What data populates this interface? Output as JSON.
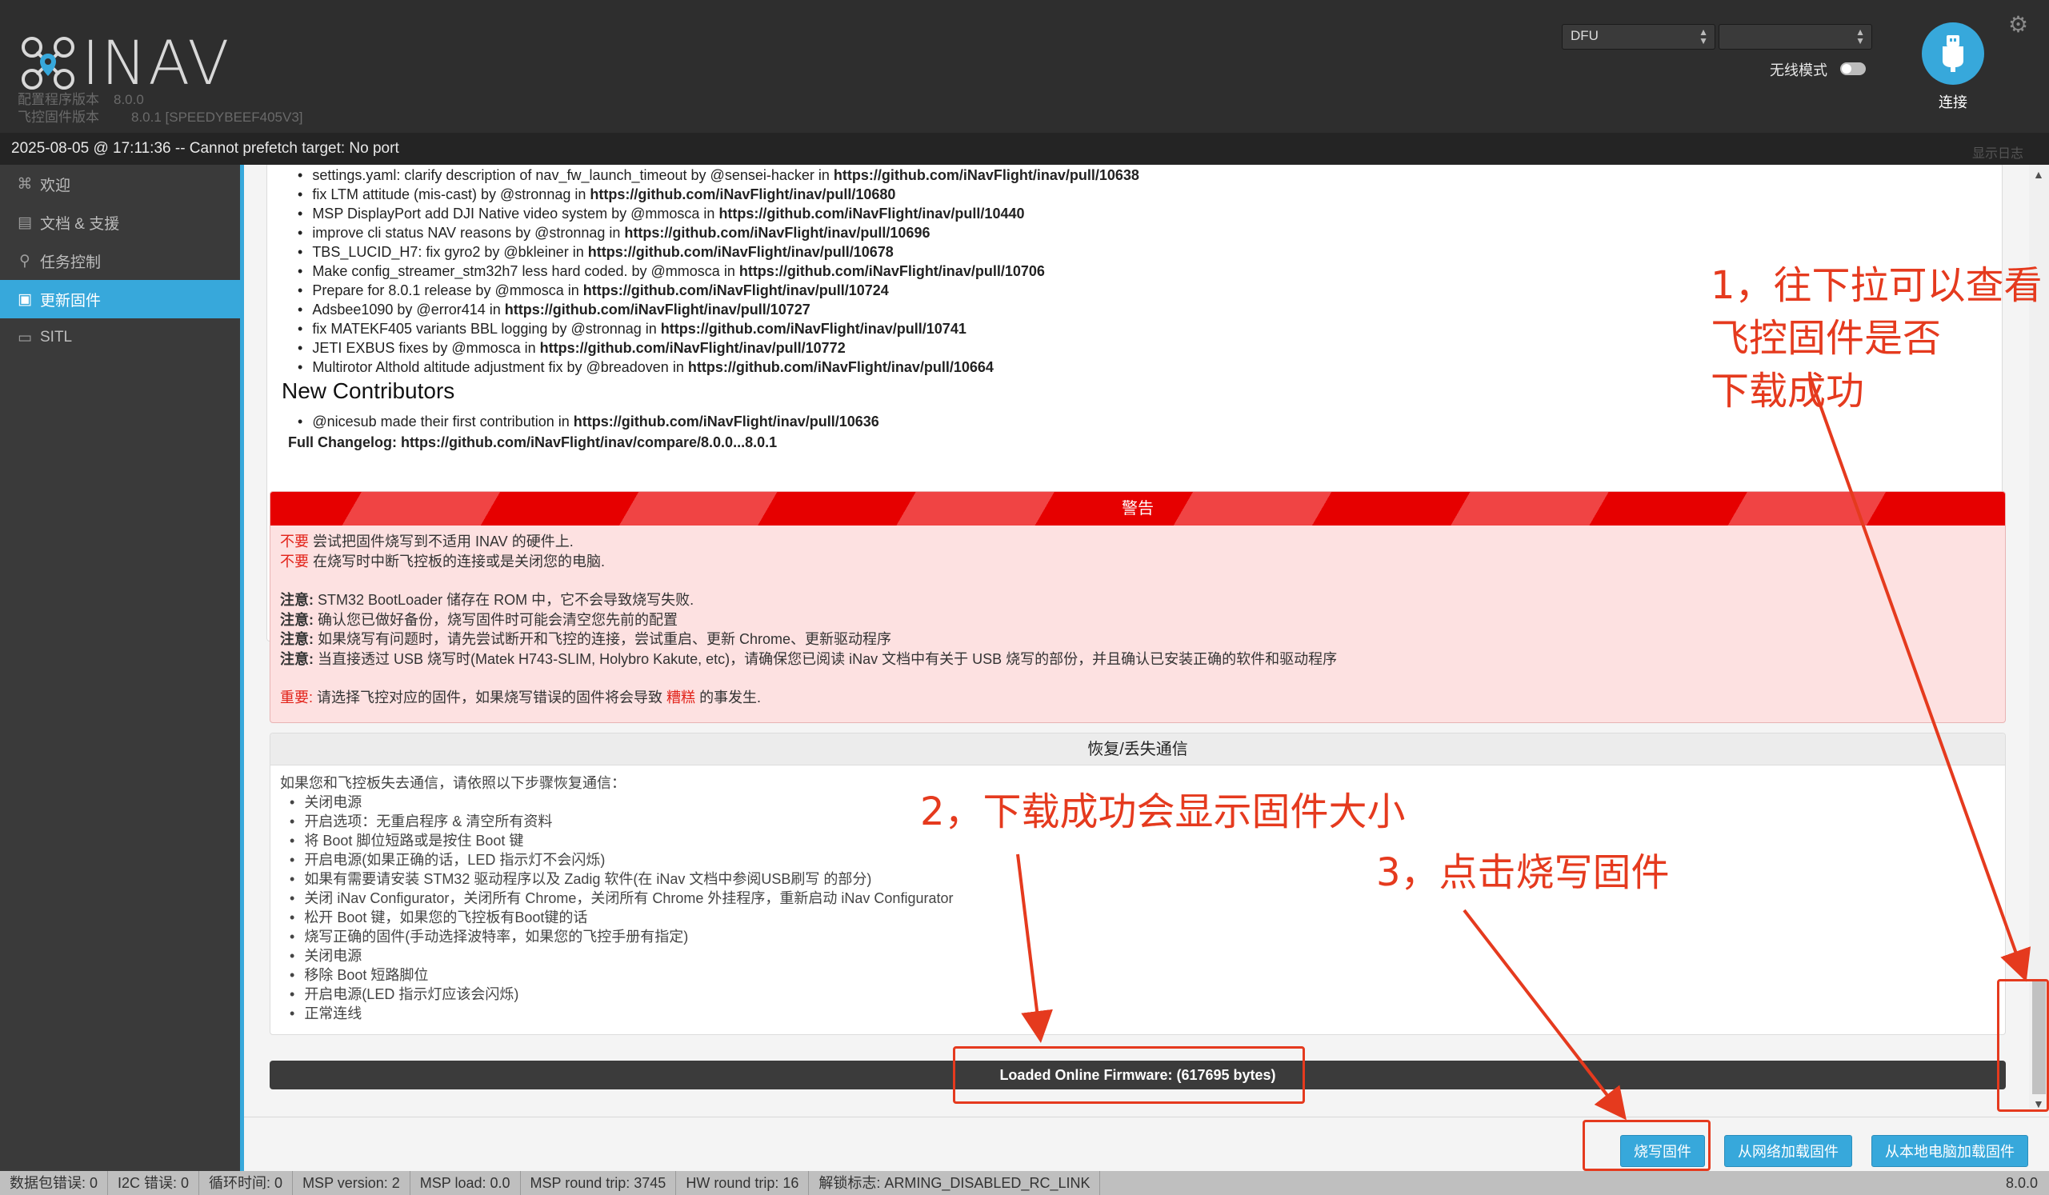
{
  "header": {
    "app_name": "INAV",
    "config_version_label": "配置程序版本",
    "config_version": "8.0.0",
    "firmware_version_label": "飞控固件版本",
    "firmware_version": "8.0.1 [SPEEDYBEEF405V3]",
    "port_select": "DFU",
    "baud_select": "",
    "wireless_label": "无线模式",
    "connect_label": "连接",
    "accent_color": "#37a8db"
  },
  "logbar": {
    "message": "2025-08-05 @ 17:11:36 -- Cannot prefetch target: No port",
    "show_log": "显示日志"
  },
  "sidebar": {
    "items": [
      {
        "label": "欢迎",
        "icon": "welcome-icon"
      },
      {
        "label": "文档 & 支援",
        "icon": "docs-icon"
      },
      {
        "label": "任务控制",
        "icon": "map-pin-icon"
      },
      {
        "label": "更新固件",
        "icon": "chip-icon",
        "active": true
      },
      {
        "label": "SITL",
        "icon": "monitor-icon"
      }
    ]
  },
  "release_notes": {
    "items": [
      {
        "text": "settings.yaml: clarify description of nav_fw_launch_timeout by @sensei-hacker in ",
        "link": "https://github.com/iNavFlight/inav/pull/10638"
      },
      {
        "text": "fix LTM attitude (mis-cast) by @stronnag in ",
        "link": "https://github.com/iNavFlight/inav/pull/10680"
      },
      {
        "text": "MSP DisplayPort add DJI Native video system by @mmosca in ",
        "link": "https://github.com/iNavFlight/inav/pull/10440"
      },
      {
        "text": "improve cli status NAV reasons by @stronnag in ",
        "link": "https://github.com/iNavFlight/inav/pull/10696"
      },
      {
        "text": "TBS_LUCID_H7: fix gyro2 by @bkleiner in ",
        "link": "https://github.com/iNavFlight/inav/pull/10678"
      },
      {
        "text": "Make config_streamer_stm32h7 less hard coded. by @mmosca in ",
        "link": "https://github.com/iNavFlight/inav/pull/10706"
      },
      {
        "text": "Prepare for 8.0.1 release by @mmosca in ",
        "link": "https://github.com/iNavFlight/inav/pull/10724"
      },
      {
        "text": "Adsbee1090 by @error414 in ",
        "link": "https://github.com/iNavFlight/inav/pull/10727"
      },
      {
        "text": "fix MATEKF405 variants BBL logging by @stronnag in ",
        "link": "https://github.com/iNavFlight/inav/pull/10741"
      },
      {
        "text": "JETI EXBUS fixes by @mmosca in ",
        "link": "https://github.com/iNavFlight/inav/pull/10772"
      },
      {
        "text": "Multirotor Althold altitude adjustment fix by @breadoven in ",
        "link": "https://github.com/iNavFlight/inav/pull/10664"
      }
    ],
    "new_contributors_title": "New Contributors",
    "contributor": {
      "text": "@nicesub made their first contribution in ",
      "link": "https://github.com/iNavFlight/inav/pull/10636"
    },
    "full_changelog_label": "Full Changelog",
    "full_changelog_link": "https://github.com/iNavFlight/inav/compare/8.0.0...8.0.1"
  },
  "warning": {
    "title": "警告",
    "line1_prefix": "不要",
    "line1": "尝试把固件烧写到不适用 INAV 的硬件上.",
    "line2_prefix": "不要",
    "line2": "在烧写时中断飞控板的连接或是关闭您的电脑.",
    "note_label": "注意:",
    "note1": "STM32 BootLoader 储存在 ROM 中，它不会导致烧写失败.",
    "note2": "确认您已做好备份，烧写固件时可能会清空您先前的配置",
    "note3": "如果烧写有问题时，请先尝试断开和飞控的连接，尝试重启、更新 Chrome、更新驱动程序",
    "note4": "当直接透过 USB 烧写时(Matek H743-SLIM, Holybro Kakute, etc)，请确保您已阅读 iNav 文档中有关于 USB 烧写的部份，并且确认已安装正确的软件和驱动程序",
    "important_label": "重要:",
    "important_a": "请选择飞控对应的固件，如果烧写错误的固件将会导致",
    "important_bad": "糟糕",
    "important_b": "的事发生."
  },
  "recovery": {
    "title": "恢复/丢失通信",
    "intro": "如果您和飞控板失去通信，请依照以下步骤恢复通信：",
    "steps": [
      "关闭电源",
      "开启选项：无重启程序 & 清空所有资料",
      "将 Boot 脚位短路或是按住 Boot 键",
      "开启电源(如果正确的话，LED 指示灯不会闪烁)",
      "如果有需要请安装 STM32 驱动程序以及 Zadig 软件(在 iNav 文档中参阅USB刷写 的部分)",
      "关闭 iNav Configurator，关闭所有 Chrome，关闭所有 Chrome 外挂程序，重新启动 iNav Configurator",
      "松开 Boot 键，如果您的飞控板有Boot键的话",
      "烧写正确的固件(手动选择波特率，如果您的飞控手册有指定)",
      "关闭电源",
      "移除 Boot 短路脚位",
      "开启电源(LED 指示灯应该会闪烁)",
      "正常连线"
    ]
  },
  "progress": {
    "label": "Loaded Online Firmware: (617695 bytes)"
  },
  "buttons": {
    "flash": "烧写固件",
    "load_online": "从网络加载固件",
    "load_local": "从本地电脑加载固件"
  },
  "statusbar": {
    "packet_errors": "数据包错误: 0",
    "i2c_errors": "I2C 错误: 0",
    "cycle_time": "循环时间: 0",
    "msp_version": "MSP version: 2",
    "msp_load": "MSP load: 0.0",
    "msp_round_trip": "MSP round trip: 3745",
    "hw_round_trip": "HW round trip: 16",
    "arming_flags": "解锁标志: ARMING_DISABLED_RC_LINK",
    "version": "8.0.0"
  },
  "annotations": {
    "note1": [
      "1，往下拉可以查看",
      "飞控固件是否",
      "下载成功"
    ],
    "note2": "2，下载成功会显示固件大小",
    "note3": "3，点击烧写固件",
    "color": "#e53a1e"
  }
}
